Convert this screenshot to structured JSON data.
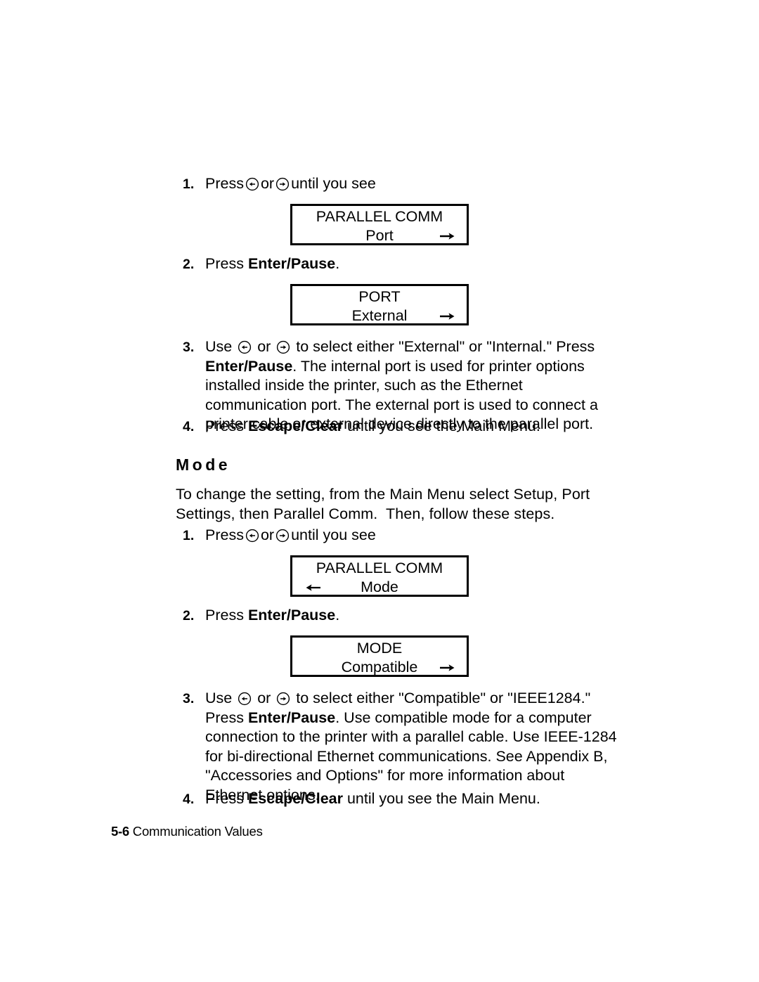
{
  "document": {
    "footer": {
      "page_number": "5-6",
      "section_title": "Communication Values"
    }
  },
  "port_section": {
    "steps": {
      "step1": {
        "number": "1.",
        "text_before": "Press",
        "text_middle": "or",
        "text_after": "until you see"
      },
      "step2": {
        "number": "2.",
        "press": "Press ",
        "key_bold": "Enter/Pause",
        "tail": "."
      },
      "step3": {
        "number": "3.",
        "lead": "Use ",
        "mid": " or ",
        "after_icons": " to select either \"External\" or \"Internal.\"  Press ",
        "key_bold": "Enter/Pause",
        "rest": ".  The internal port is used for printer options installed inside the printer, such as the Ethernet communication port.  The external port is used to connect a printer cable or external device directly to the parallel port."
      },
      "step4": {
        "number": "4.",
        "lead": "Press ",
        "key_bold": "Escape/Clear",
        "rest": " until you see the Main Menu."
      }
    },
    "display_parallel_comm": {
      "line1": "PARALLEL COMM",
      "line2": "Port",
      "arrow_right": "right-arrow",
      "has_left_arrow": false
    },
    "display_port": {
      "line1": "PORT",
      "line2": "External",
      "arrow_right": "right-arrow",
      "has_left_arrow": false
    }
  },
  "mode_section": {
    "heading": "Mode",
    "intro": "To change the setting, from the Main Menu select Setup, Port Settings, then Parallel Comm.  Then, follow these steps.",
    "steps": {
      "step1": {
        "number": "1.",
        "text_before": "Press",
        "text_middle": "or",
        "text_after": "until you see"
      },
      "step2": {
        "number": "2.",
        "press": "Press ",
        "key_bold": "Enter/Pause",
        "tail": "."
      },
      "step3": {
        "number": "3.",
        "lead": "Use ",
        "mid": " or ",
        "after_icons": " to select either \"Compatible\" or \"IEEE1284.\"  Press ",
        "key_bold": "Enter/Pause",
        "rest": ".  Use compatible mode for a computer connection to the printer with a parallel cable.  Use IEEE-1284 for bi-directional Ethernet communications.  See Appendix B, \"Accessories and Options\" for more information about Ethernet options."
      },
      "step4": {
        "number": "4.",
        "lead": "Press ",
        "key_bold": "Escape/Clear",
        "rest": " until you see the Main Menu."
      }
    },
    "display_parallel_comm": {
      "line1": "PARALLEL COMM",
      "line2": "Mode",
      "arrow_left": "left-arrow",
      "has_left_arrow": true
    },
    "display_mode": {
      "line1": "MODE",
      "line2": "Compatible",
      "arrow_right": "right-arrow",
      "has_left_arrow": false
    }
  },
  "colors": {
    "ink": "#000000",
    "paper": "#ffffff"
  }
}
